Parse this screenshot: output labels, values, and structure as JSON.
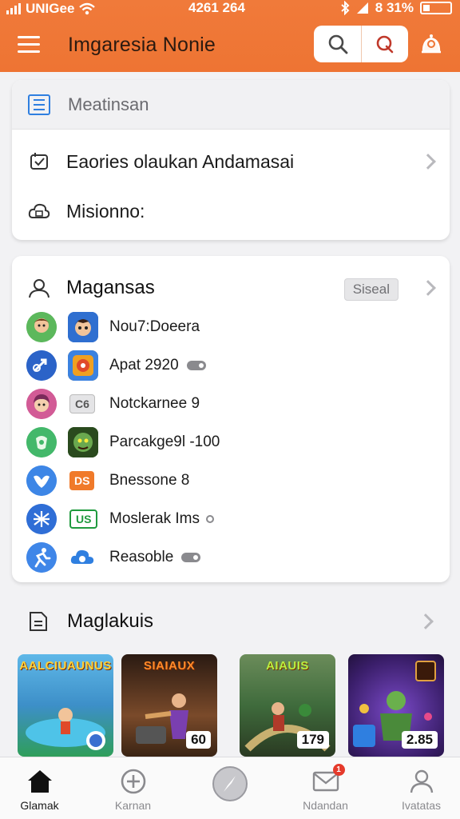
{
  "status_bar": {
    "carrier": "UNIGee",
    "time": "4261 264",
    "battery": "8 31%"
  },
  "header": {
    "title": "Imgaresia Nonie",
    "icons": [
      "menu-icon",
      "search-icon",
      "profile-q-icon",
      "alarm-bell-icon"
    ],
    "accent_color": "#ee7433"
  },
  "search": {
    "placeholder": "Meatinsan"
  },
  "menu_rows": [
    {
      "label": "Eaories olaukan Andamasai",
      "icon": "calendar-check-icon"
    },
    {
      "label": "Misionno:",
      "icon": "cloud-box-icon"
    }
  ],
  "games_section": {
    "title": "Magansas",
    "badge": "Siseal",
    "items": [
      {
        "name": "Nou7:Doeera",
        "avatar_color": "#4aa84a",
        "thumb_color": "#2f6fd0"
      },
      {
        "name": "Apat 2920",
        "avatar_color": "#2b63c8",
        "thumb_color": "#e08a1c"
      },
      {
        "name": "Notckarnee 9",
        "avatar_color": "#c94a8a",
        "tag": "C6"
      },
      {
        "name": "Parcakge9l -100",
        "avatar_color": "#43b86a",
        "thumb_color": "#3e7a2c"
      },
      {
        "name": "Bnessone 8",
        "avatar_color": "#3d86e6",
        "tag": "DS"
      },
      {
        "name": "Moslerak Ims",
        "avatar_color": "#2f6ed6",
        "tag": "US"
      },
      {
        "name": "Reasoble",
        "avatar_color": "#3f86e8",
        "tag": ""
      }
    ]
  },
  "featured_section": {
    "title": "Maglakuis",
    "tiles": [
      {
        "title": "AALCIUAUNUS",
        "score": "",
        "bg": "#3b9fd6"
      },
      {
        "title": "SIAIAUX",
        "score": "60",
        "bg": "#6b3a1d"
      },
      {
        "title": "AIAUIS",
        "score": "179",
        "bg": "#3f6b3c"
      },
      {
        "title": "",
        "score": "2.85",
        "bg": "#4a2a7a"
      }
    ]
  },
  "bottom_nav": [
    {
      "label": "Glamak",
      "icon": "home-icon",
      "active": true
    },
    {
      "label": "Karnan",
      "icon": "plus-circle-icon",
      "active": false
    },
    {
      "label": "",
      "icon": "compass-icon",
      "active": false
    },
    {
      "label": "Ndandan",
      "icon": "mail-icon",
      "active": false,
      "badge": "1"
    },
    {
      "label": "Ivatatas",
      "icon": "profile-icon",
      "active": false
    }
  ]
}
